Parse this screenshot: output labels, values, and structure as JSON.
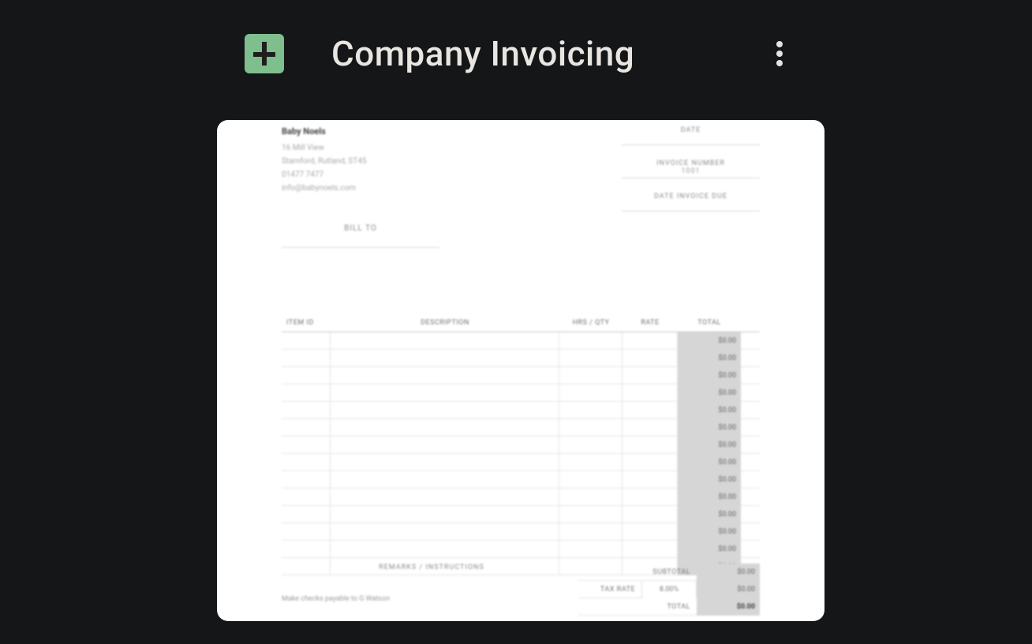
{
  "header": {
    "title": "Company Invoicing"
  },
  "doc": {
    "company_name": "Baby Noels",
    "address_line1": "16 Mill View",
    "address_line2": "Stamford, Rutland, ST45",
    "phone": "01477 7477",
    "email": "info@babynoels.com",
    "labels": {
      "date": "DATE",
      "invoice_number": "INVOICE NUMBER",
      "date_invoice_due": "DATE INVOICE DUE",
      "bill_to": "BILL TO"
    },
    "invoice_number_value": "1001",
    "table": {
      "headers": {
        "item_id": "ITEM ID",
        "description": "DESCRIPTION",
        "hrs_qty": "HRS / QTY",
        "rate": "RATE",
        "total": "TOTAL"
      },
      "row_totals": [
        "$0.00",
        "$0.00",
        "$0.00",
        "$0.00",
        "$0.00",
        "$0.00",
        "$0.00",
        "$0.00",
        "$0.00",
        "$0.00",
        "$0.00",
        "$0.00",
        "$0.00",
        "$0.00"
      ]
    },
    "remarks_label": "REMARKS / INSTRUCTIONS",
    "remarks_text": "Make checks payable to G Watson",
    "summary": {
      "subtotal_label": "SUBTOTAL",
      "subtotal_value": "$0.00",
      "tax_rate_label": "TAX RATE",
      "tax_rate_value": "8.00%",
      "tax_value": "$0.00",
      "total_label": "TOTAL",
      "total_value": "$0.00"
    }
  }
}
